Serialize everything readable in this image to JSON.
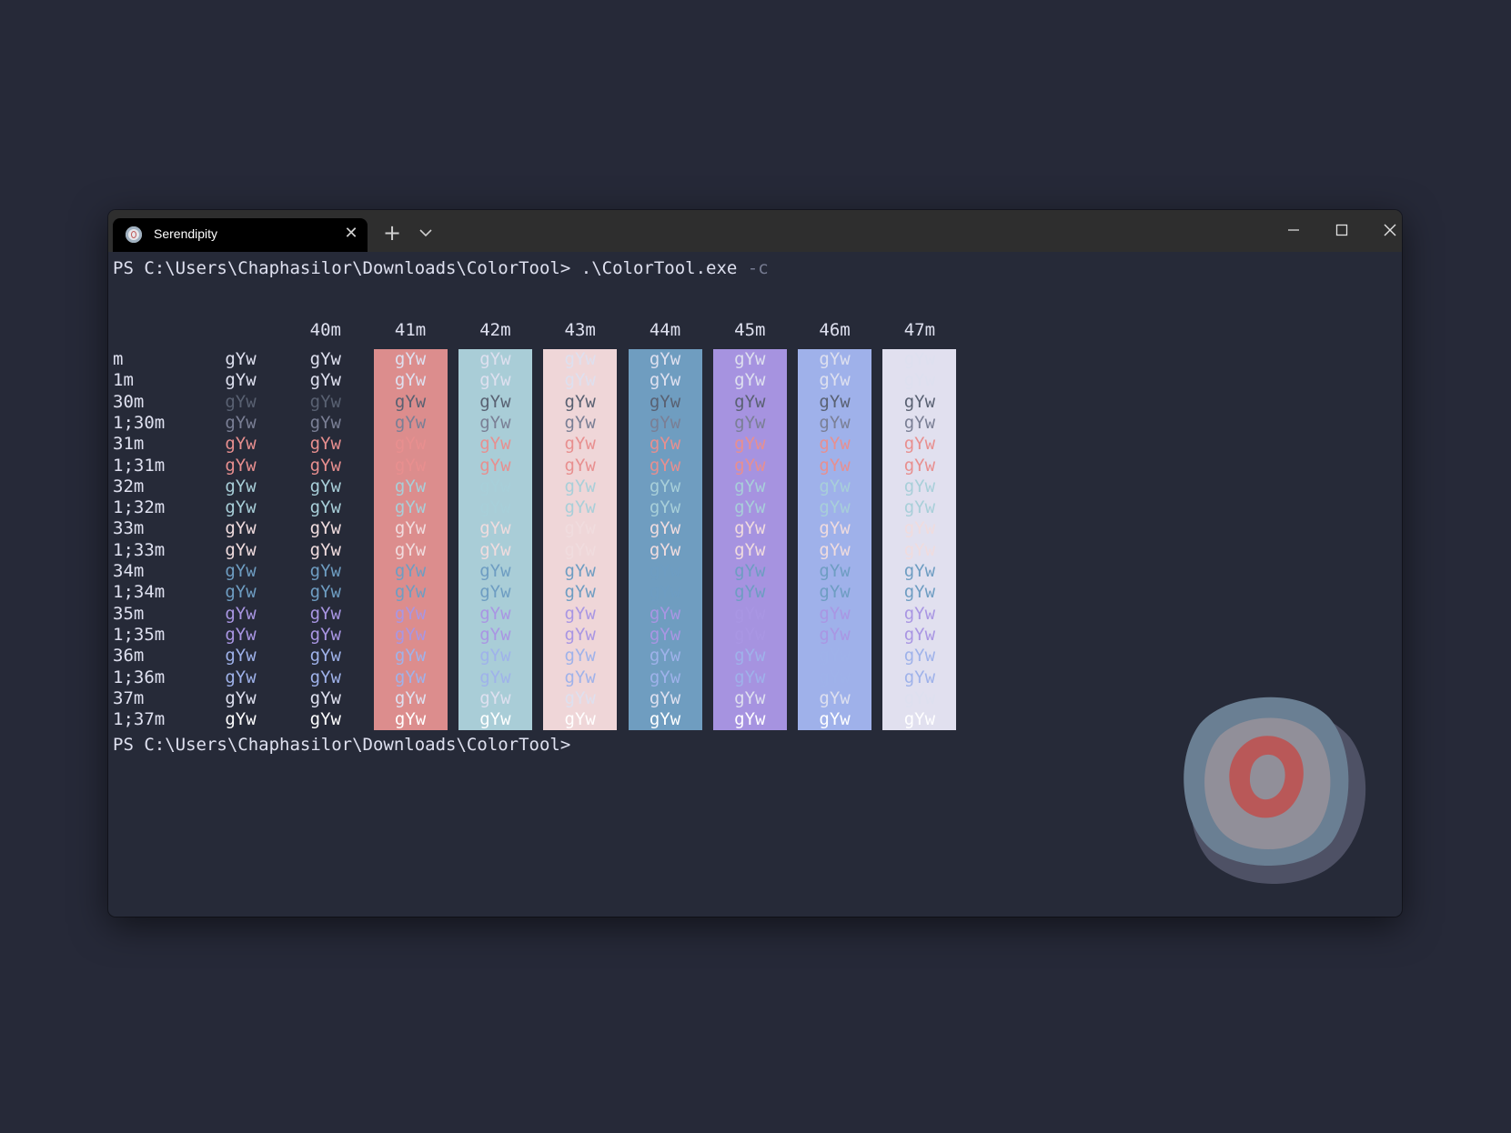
{
  "tab": {
    "title": "Serendipity",
    "icon": "serendipity-app-icon"
  },
  "prompt": {
    "line1": "PS C:\\Users\\Chaphasilor\\Downloads\\ColorTool> ",
    "command": ".\\ColorTool.exe",
    "flag": " -c",
    "line2": "PS C:\\Users\\Chaphasilor\\Downloads\\ColorTool>"
  },
  "color_table": {
    "bg_headers": [
      "40m",
      "41m",
      "42m",
      "43m",
      "44m",
      "45m",
      "46m",
      "47m"
    ],
    "row_labels": [
      "m",
      "1m",
      "30m",
      "1;30m",
      "31m",
      "1;31m",
      "32m",
      "1;32m",
      "33m",
      "1;33m",
      "34m",
      "1;34m",
      "35m",
      "1;35m",
      "36m",
      "1;36m",
      "37m",
      "1;37m"
    ],
    "sample_text": "gYw",
    "bg_colors": [
      "#dc8d8d",
      "#a9cdd7",
      "#efd6d8",
      "#6f9dc0",
      "#a693e0",
      "#9fb1ea",
      "#e1e0ef"
    ],
    "fg_colors": [
      "#dee0ef",
      "#dee0ef",
      "#596172",
      "#7a7f95",
      "#e88f8f",
      "#e88f8f",
      "#a8cfd9",
      "#a8cfd9",
      "#f0dcde",
      "#f0dcde",
      "#6e9dc2",
      "#6e9dc2",
      "#a996e3",
      "#a996e3",
      "#9fb2ea",
      "#9fb2ea",
      "#dee0ef",
      "#ffffff"
    ]
  }
}
